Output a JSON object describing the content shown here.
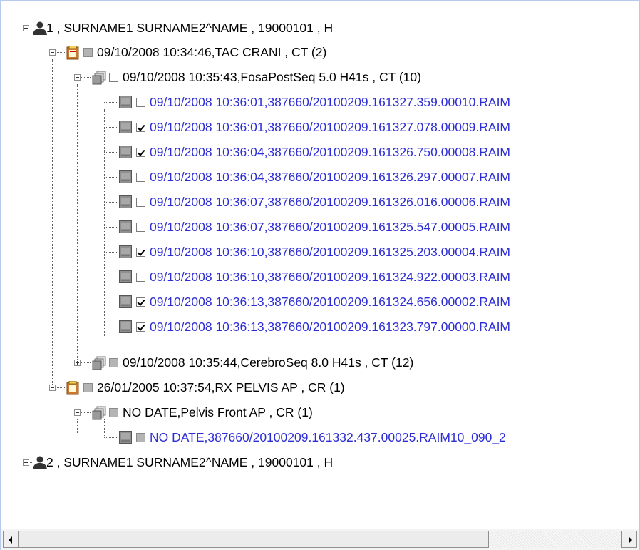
{
  "tree": {
    "patients": [
      {
        "label": "1 , SURNAME1 SURNAME2^NAME , 19000101 , H",
        "expanded": true,
        "studies": [
          {
            "label": "09/10/2008 10:34:46,TAC CRANI , CT (2)",
            "checkbox": "gray",
            "expanded": true,
            "series": [
              {
                "label": "09/10/2008 10:35:43,FosaPostSeq 5.0 H41s , CT (10)",
                "checkbox": "unchecked",
                "expanded": true,
                "images": [
                  {
                    "label": "09/10/2008 10:36:01,387660/20100209.161327.359.00010.RAIM",
                    "checked": false
                  },
                  {
                    "label": "09/10/2008 10:36:01,387660/20100209.161327.078.00009.RAIM",
                    "checked": true
                  },
                  {
                    "label": "09/10/2008 10:36:04,387660/20100209.161326.750.00008.RAIM",
                    "checked": true
                  },
                  {
                    "label": "09/10/2008 10:36:04,387660/20100209.161326.297.00007.RAIM",
                    "checked": false
                  },
                  {
                    "label": "09/10/2008 10:36:07,387660/20100209.161326.016.00006.RAIM",
                    "checked": false
                  },
                  {
                    "label": "09/10/2008 10:36:07,387660/20100209.161325.547.00005.RAIM",
                    "checked": false
                  },
                  {
                    "label": "09/10/2008 10:36:10,387660/20100209.161325.203.00004.RAIM",
                    "checked": true
                  },
                  {
                    "label": "09/10/2008 10:36:10,387660/20100209.161324.922.00003.RAIM",
                    "checked": false
                  },
                  {
                    "label": "09/10/2008 10:36:13,387660/20100209.161324.656.00002.RAIM",
                    "checked": true
                  },
                  {
                    "label": "09/10/2008 10:36:13,387660/20100209.161323.797.00000.RAIM",
                    "checked": true
                  }
                ]
              },
              {
                "label": "09/10/2008 10:35:44,CerebroSeq 8.0 H41s , CT (12)",
                "checkbox": "gray",
                "expanded": false
              }
            ]
          },
          {
            "label": "26/01/2005 10:37:54,RX PELVIS AP , CR (1)",
            "checkbox": "gray",
            "expanded": true,
            "series": [
              {
                "label": "NO DATE,Pelvis Front AP , CR (1)",
                "checkbox": "gray",
                "expanded": true,
                "images": [
                  {
                    "label": "NO DATE,387660/20100209.161332.437.00025.RAIM10_090_2",
                    "checked": false,
                    "checkbox": "gray"
                  }
                ]
              }
            ]
          }
        ]
      },
      {
        "label": "2 , SURNAME1 SURNAME2^NAME , 19000101 , H",
        "expanded": false
      }
    ]
  },
  "colors": {
    "image_text": "#2d2dd6",
    "normal_text": "#000000",
    "border": "#b7c9ec"
  },
  "icons": {
    "patient": "person-icon",
    "study": "clipboard-icon",
    "series": "image-stack-icon",
    "image": "image-icon"
  },
  "scrollbar": {
    "horizontal": true
  }
}
